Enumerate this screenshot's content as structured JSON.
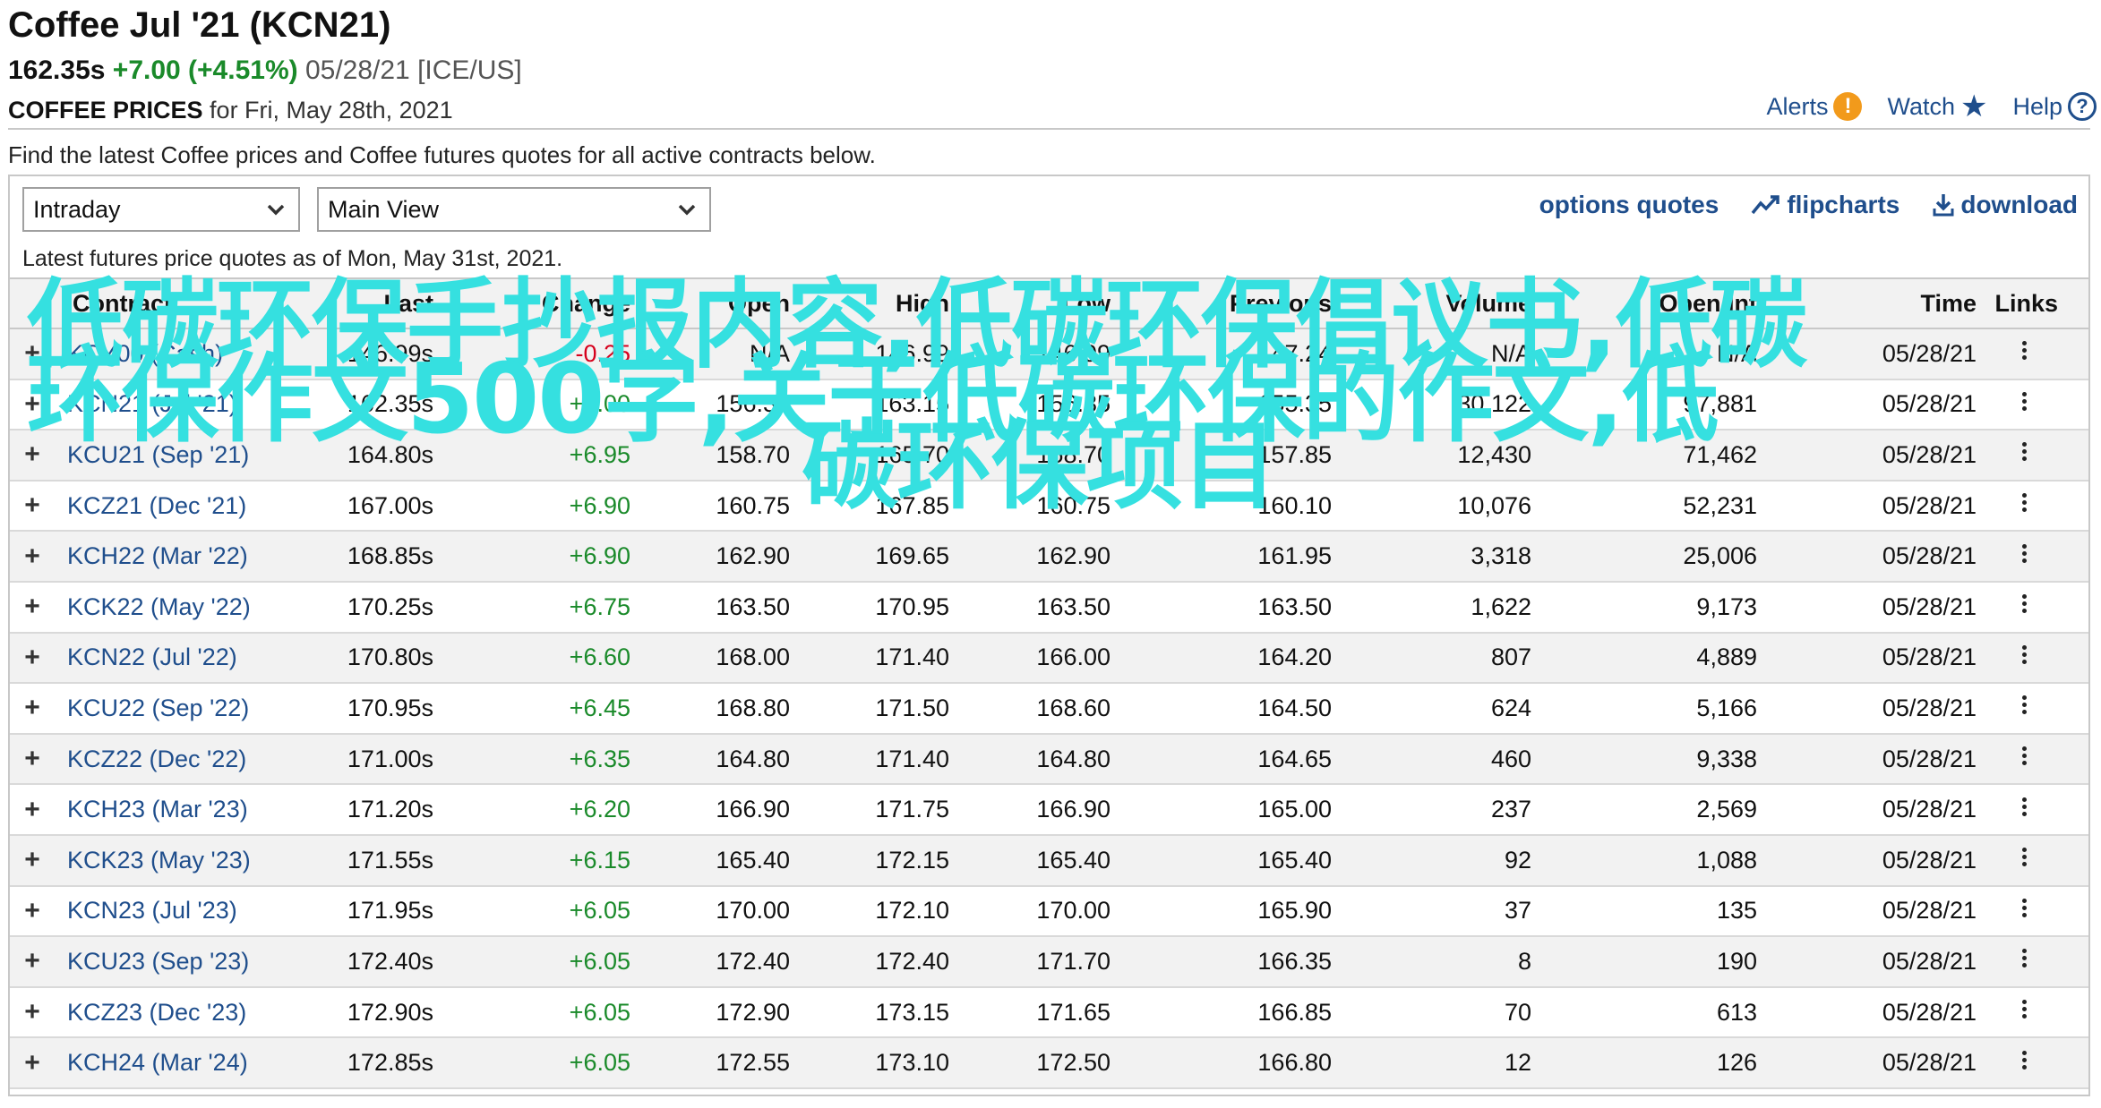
{
  "header": {
    "title": "Coffee Jul '21 (KCN21)",
    "price": "162.35s",
    "change": "+7.00 (+4.51%)",
    "date_exchange": "05/28/21 [ICE/US]",
    "prices_label": "COFFEE PRICES",
    "prices_for": "for Fri, May 28th, 2021"
  },
  "toplinks": {
    "alerts": "Alerts",
    "watch": "Watch",
    "help": "Help"
  },
  "description": "Find the latest Coffee prices and Coffee futures quotes for all active contracts below.",
  "controls": {
    "view_period": "Intraday",
    "view_mode": "Main View",
    "options_quotes": "options quotes",
    "flipcharts": "flipcharts",
    "download": "download"
  },
  "asof": "Latest futures price quotes as of Mon, May 31st, 2021.",
  "table": {
    "columns": [
      "Contract",
      "Last",
      "Change",
      "Open",
      "High",
      "Low",
      "Previous",
      "Volume",
      "Open Int",
      "Time",
      "Links"
    ],
    "rows": [
      {
        "contract": "KCY00 (Cash)",
        "last": "146.99s",
        "change": "-0.25",
        "dir": "neg",
        "open": "N/A",
        "high": "146.99",
        "low": "146.99",
        "previous": "147.24",
        "volume": "N/A",
        "open_int": "N/A",
        "time": "05/28/21"
      },
      {
        "contract": "KCN21 (Jul '21)",
        "last": "162.35s",
        "change": "+7.00",
        "dir": "pos",
        "open": "156.35",
        "high": "163.15",
        "low": "156.35",
        "previous": "155.35",
        "volume": "30,122",
        "open_int": "97,881",
        "time": "05/28/21"
      },
      {
        "contract": "KCU21 (Sep '21)",
        "last": "164.80s",
        "change": "+6.95",
        "dir": "pos",
        "open": "158.70",
        "high": "165.70",
        "low": "158.70",
        "previous": "157.85",
        "volume": "12,430",
        "open_int": "71,462",
        "time": "05/28/21"
      },
      {
        "contract": "KCZ21 (Dec '21)",
        "last": "167.00s",
        "change": "+6.90",
        "dir": "pos",
        "open": "160.75",
        "high": "167.85",
        "low": "160.75",
        "previous": "160.10",
        "volume": "10,076",
        "open_int": "52,231",
        "time": "05/28/21"
      },
      {
        "contract": "KCH22 (Mar '22)",
        "last": "168.85s",
        "change": "+6.90",
        "dir": "pos",
        "open": "162.90",
        "high": "169.65",
        "low": "162.90",
        "previous": "161.95",
        "volume": "3,318",
        "open_int": "25,006",
        "time": "05/28/21"
      },
      {
        "contract": "KCK22 (May '22)",
        "last": "170.25s",
        "change": "+6.75",
        "dir": "pos",
        "open": "163.50",
        "high": "170.95",
        "low": "163.50",
        "previous": "163.50",
        "volume": "1,622",
        "open_int": "9,173",
        "time": "05/28/21"
      },
      {
        "contract": "KCN22 (Jul '22)",
        "last": "170.80s",
        "change": "+6.60",
        "dir": "pos",
        "open": "168.00",
        "high": "171.40",
        "low": "166.00",
        "previous": "164.20",
        "volume": "807",
        "open_int": "4,889",
        "time": "05/28/21"
      },
      {
        "contract": "KCU22 (Sep '22)",
        "last": "170.95s",
        "change": "+6.45",
        "dir": "pos",
        "open": "168.80",
        "high": "171.50",
        "low": "168.60",
        "previous": "164.50",
        "volume": "624",
        "open_int": "5,166",
        "time": "05/28/21"
      },
      {
        "contract": "KCZ22 (Dec '22)",
        "last": "171.00s",
        "change": "+6.35",
        "dir": "pos",
        "open": "164.80",
        "high": "171.40",
        "low": "164.80",
        "previous": "164.65",
        "volume": "460",
        "open_int": "9,338",
        "time": "05/28/21"
      },
      {
        "contract": "KCH23 (Mar '23)",
        "last": "171.20s",
        "change": "+6.20",
        "dir": "pos",
        "open": "166.90",
        "high": "171.75",
        "low": "166.90",
        "previous": "165.00",
        "volume": "237",
        "open_int": "2,569",
        "time": "05/28/21"
      },
      {
        "contract": "KCK23 (May '23)",
        "last": "171.55s",
        "change": "+6.15",
        "dir": "pos",
        "open": "165.40",
        "high": "172.15",
        "low": "165.40",
        "previous": "165.40",
        "volume": "92",
        "open_int": "1,088",
        "time": "05/28/21"
      },
      {
        "contract": "KCN23 (Jul '23)",
        "last": "171.95s",
        "change": "+6.05",
        "dir": "pos",
        "open": "170.00",
        "high": "172.10",
        "low": "170.00",
        "previous": "165.90",
        "volume": "37",
        "open_int": "135",
        "time": "05/28/21"
      },
      {
        "contract": "KCU23 (Sep '23)",
        "last": "172.40s",
        "change": "+6.05",
        "dir": "pos",
        "open": "172.40",
        "high": "172.40",
        "low": "171.70",
        "previous": "166.35",
        "volume": "8",
        "open_int": "190",
        "time": "05/28/21"
      },
      {
        "contract": "KCZ23 (Dec '23)",
        "last": "172.90s",
        "change": "+6.05",
        "dir": "pos",
        "open": "172.90",
        "high": "173.15",
        "low": "171.65",
        "previous": "166.85",
        "volume": "70",
        "open_int": "613",
        "time": "05/28/21"
      },
      {
        "contract": "KCH24 (Mar '24)",
        "last": "172.85s",
        "change": "+6.05",
        "dir": "pos",
        "open": "172.55",
        "high": "173.10",
        "low": "172.50",
        "previous": "166.80",
        "volume": "12",
        "open_int": "126",
        "time": "05/28/21"
      }
    ]
  },
  "overlay": {
    "line1": "低碳环保手抄报内容,低碳环保倡议书,低碳",
    "line2": "环保作文500字,关于低碳环保的作文,低",
    "line3": "碳环保项目"
  },
  "colors": {
    "link": "#1f4e8c",
    "positive": "#1a8a2a",
    "negative": "#d6001c",
    "overlay_text": "#35e0e0",
    "alert": "#f29a1b"
  }
}
